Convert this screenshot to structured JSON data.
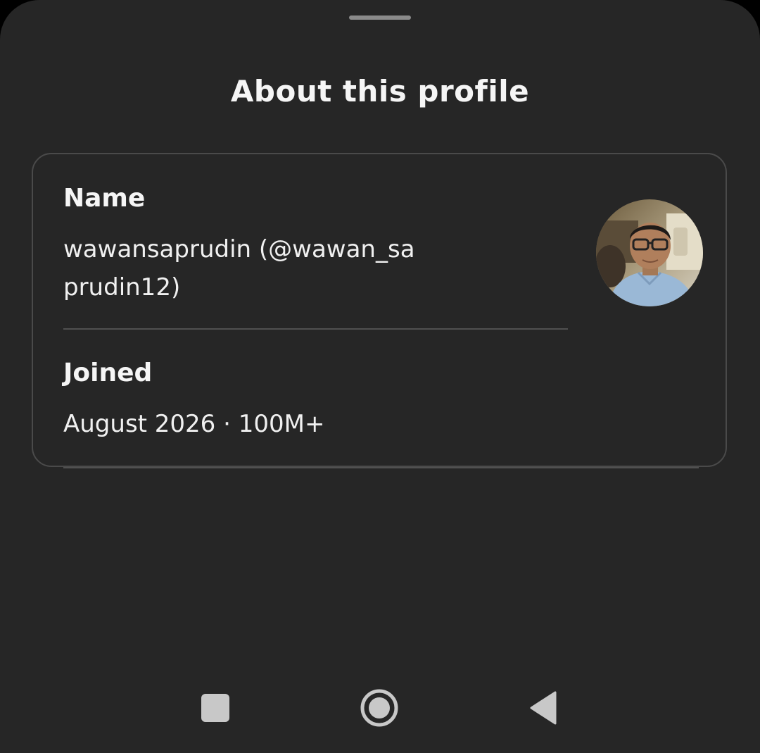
{
  "sheet": {
    "title": "About this profile"
  },
  "profile": {
    "name_label": "Name",
    "name_value": "wawansaprudin (@wawan_saprudin12)",
    "joined_label": "Joined",
    "joined_value": "August 2026 · 100M+",
    "avatar_icon": "profile-photo"
  },
  "navigation": {
    "recents_icon": "square-icon",
    "home_icon": "circle-icon",
    "back_icon": "triangle-back-icon"
  },
  "colors": {
    "background": "#262626",
    "text": "#f5f5f5",
    "border": "#4a4a4a"
  }
}
